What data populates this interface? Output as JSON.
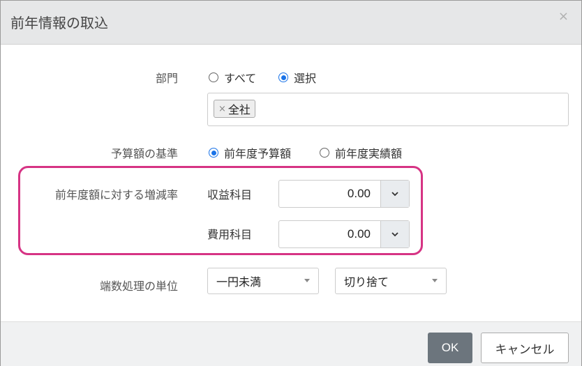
{
  "dialog": {
    "title": "前年情報の取込",
    "close_label": "×"
  },
  "department": {
    "label": "部門",
    "options": [
      "すべて",
      "選択"
    ],
    "selected": "選択",
    "tags": [
      {
        "label": "全社",
        "remove": "×"
      }
    ]
  },
  "budget_basis": {
    "label": "予算額の基準",
    "options": [
      "前年度予算額",
      "前年度実績額"
    ],
    "selected": "前年度予算額"
  },
  "rate": {
    "label": "前年度額に対する増減率",
    "revenue_label": "収益科目",
    "revenue_value": "0.00",
    "expense_label": "費用科目",
    "expense_value": "0.00"
  },
  "rounding": {
    "label": "端数処理の単位",
    "unit_value": "一円未満",
    "method_value": "切り捨て"
  },
  "footer": {
    "ok_label": "OK",
    "cancel_label": "キャンセル"
  },
  "colors": {
    "highlight": "#d63384",
    "radio_checked": "#1a73e8",
    "ok_button": "#6c757d"
  }
}
